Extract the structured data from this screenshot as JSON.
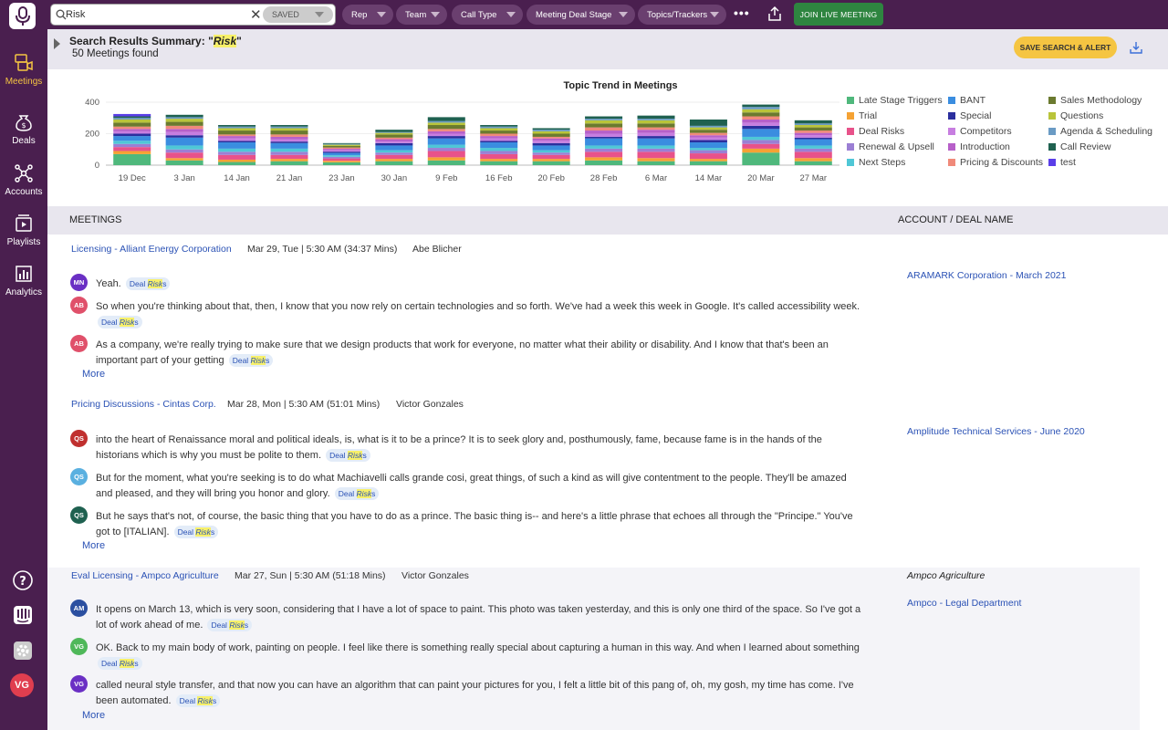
{
  "sidebar": {
    "items": [
      {
        "label": "Meetings",
        "icon": "chat-video-icon",
        "active": true
      },
      {
        "label": "Deals",
        "icon": "money-bag-icon"
      },
      {
        "label": "Accounts",
        "icon": "network-icon"
      },
      {
        "label": "Playlists",
        "icon": "playlist-icon"
      },
      {
        "label": "Analytics",
        "icon": "analytics-icon"
      }
    ],
    "avatar": "VG"
  },
  "topbar": {
    "search_value": "Risk",
    "saved_label": "SAVED",
    "filters": [
      "Rep",
      "Team",
      "Call Type",
      "Meeting Deal Stage",
      "Topics/Trackers"
    ],
    "more": "•••",
    "join_label": "JOIN LIVE MEETING"
  },
  "summary": {
    "title_prefix": "Search Results Summary: \"",
    "term": "Risk",
    "title_suffix": "\"",
    "count": "50 Meetings found",
    "save_alert_label": "SAVE SEARCH & ALERT"
  },
  "chart_data": {
    "type": "bar",
    "stacked": true,
    "title": "Topic Trend in Meetings",
    "categories": [
      "19 Dec",
      "3 Jan",
      "14 Jan",
      "21 Jan",
      "23 Jan",
      "30 Jan",
      "9 Feb",
      "16 Feb",
      "20 Feb",
      "28 Feb",
      "6 Mar",
      "14 Mar",
      "20 Mar",
      "27 Mar"
    ],
    "yticks": [
      0,
      200,
      400
    ],
    "ylim": [
      0,
      400
    ],
    "grid": true,
    "legend_position": "right",
    "series": [
      {
        "name": "Late Stage Triggers",
        "color": "#4fb87c",
        "values": [
          70,
          30,
          20,
          25,
          18,
          25,
          30,
          25,
          25,
          30,
          25,
          25,
          80,
          25
        ]
      },
      {
        "name": "Trial",
        "color": "#f5a234",
        "values": [
          20,
          15,
          15,
          15,
          10,
          15,
          20,
          15,
          15,
          20,
          20,
          15,
          25,
          20
        ]
      },
      {
        "name": "Deal Risks",
        "color": "#e8528a",
        "values": [
          25,
          35,
          30,
          25,
          15,
          25,
          40,
          30,
          25,
          35,
          40,
          35,
          30,
          40
        ]
      },
      {
        "name": "Renewal & Upsell",
        "color": "#9b7fd4",
        "values": [
          20,
          20,
          20,
          20,
          10,
          15,
          20,
          20,
          15,
          20,
          20,
          20,
          25,
          20
        ]
      },
      {
        "name": "Next Steps",
        "color": "#4fc7d6",
        "values": [
          20,
          25,
          20,
          20,
          10,
          15,
          20,
          20,
          15,
          20,
          20,
          15,
          20,
          20
        ]
      },
      {
        "name": "BANT",
        "color": "#3a8de0",
        "values": [
          30,
          50,
          40,
          35,
          15,
          30,
          40,
          35,
          30,
          45,
          45,
          35,
          50,
          40
        ]
      },
      {
        "name": "Special",
        "color": "#2b2f9e",
        "values": [
          15,
          15,
          10,
          10,
          8,
          15,
          15,
          10,
          15,
          10,
          15,
          15,
          20,
          10
        ]
      },
      {
        "name": "Competitors",
        "color": "#c77ee0",
        "values": [
          15,
          20,
          15,
          15,
          10,
          10,
          15,
          15,
          15,
          20,
          20,
          15,
          20,
          15
        ]
      },
      {
        "name": "Introduction",
        "color": "#b760c9",
        "values": [
          15,
          20,
          15,
          15,
          8,
          15,
          15,
          15,
          15,
          20,
          20,
          15,
          20,
          15
        ]
      },
      {
        "name": "Pricing & Discounts",
        "color": "#f08a7a",
        "values": [
          15,
          20,
          10,
          15,
          8,
          10,
          15,
          15,
          10,
          20,
          15,
          15,
          20,
          15
        ]
      },
      {
        "name": "Sales Methodology",
        "color": "#6b7a2f",
        "values": [
          25,
          25,
          25,
          25,
          10,
          20,
          25,
          20,
          20,
          25,
          25,
          20,
          25,
          20
        ]
      },
      {
        "name": "Questions",
        "color": "#b9c43a",
        "values": [
          20,
          20,
          15,
          15,
          8,
          10,
          15,
          15,
          15,
          20,
          20,
          15,
          20,
          15
        ]
      },
      {
        "name": "Agenda & Scheduling",
        "color": "#6a9bc4",
        "values": [
          10,
          10,
          10,
          10,
          5,
          5,
          10,
          10,
          10,
          10,
          10,
          10,
          15,
          10
        ]
      },
      {
        "name": "Call Review",
        "color": "#1f6150",
        "values": [
          10,
          15,
          10,
          10,
          5,
          15,
          25,
          10,
          10,
          15,
          20,
          40,
          15,
          20
        ]
      },
      {
        "name": "test",
        "color": "#5a3ee8",
        "values": [
          15,
          0,
          0,
          0,
          0,
          0,
          0,
          0,
          0,
          0,
          0,
          0,
          0,
          0
        ]
      }
    ]
  },
  "list_header": {
    "meetings": "MEETINGS",
    "account": "ACCOUNT / DEAL NAME"
  },
  "meetings": [
    {
      "title": "Licensing - Alliant Energy Corporation",
      "date": "Mar 29, Tue | 5:30 AM (34:37 Mins)",
      "rep": "Abe Blicher",
      "account": "ARAMARK Corporation - March 2021",
      "snippets": [
        {
          "initials": "MN",
          "color": "#6a2fc4",
          "text": "Yeah."
        },
        {
          "initials": "AB",
          "color": "#e0506a",
          "text": "So when you're thinking about that, then, I know that you now rely on certain technologies and so forth. We've had a week this week in Google. It's called accessibility week."
        },
        {
          "initials": "AB",
          "color": "#e0506a",
          "text": "As a company, we're really trying to make sure that we design products that work for everyone, no matter what their ability or disability. And I know that that's been an important part of your getting"
        }
      ],
      "more": "More"
    },
    {
      "title": "Pricing Discussions - Cintas Corp.",
      "date": "Mar 28, Mon | 5:30 AM (51:01 Mins)",
      "rep": "Victor Gonzales",
      "account": "Amplitude Technical Services - June 2020",
      "snippets": [
        {
          "initials": "QS",
          "color": "#c0302f",
          "text": "into the heart of Renaissance moral and political ideals, is, what is it to be a prince? It is to seek glory and, posthumously, fame, because fame is in the hands of the historians which is why you must be polite to them."
        },
        {
          "initials": "QS",
          "color": "#5ab0e0",
          "text": "But for the moment, what you're seeking is to do what Machiavelli calls grande cosi, great things, of such a kind as will give contentment to the people. They'll be amazed and pleased, and they will bring you honor and glory."
        },
        {
          "initials": "QS",
          "color": "#1f6150",
          "text": "But he says that's not, of course, the basic thing that you have to do as a prince. The basic thing is-- and here's a little phrase that echoes all through the \"Principe.\" You've got to [ITALIAN]."
        }
      ],
      "more": "More"
    },
    {
      "title": "Eval Licensing - Ampco Agriculture",
      "date": "Mar 27, Sun | 5:30 AM (51:18 Mins)",
      "rep": "Victor Gonzales",
      "account_italic": "Ampco Agriculture",
      "account": "Ampco - Legal Department",
      "snippets": [
        {
          "initials": "AM",
          "color": "#2b4fa0",
          "text": "It opens on March 13, which is very soon, considering that I have a lot of space to paint. This photo was taken yesterday, and this is only one third of the space. So I've got a lot of work ahead of me."
        },
        {
          "initials": "VG",
          "color": "#4fb85a",
          "text": "OK. Back to my main body of work, painting on people. I feel like there is something really special about capturing a human in this way. And when I learned about something"
        },
        {
          "initials": "VG",
          "color": "#6a2fc4",
          "text": "called neural style transfer, and that now you can have an algorithm that can paint your pictures for you, I felt a little bit of this pang of, oh, my gosh, my time has come. I've been automated."
        }
      ],
      "more": "More"
    }
  ],
  "tag": {
    "prefix": "Deal ",
    "term": "Risk",
    "suffix": "s"
  }
}
